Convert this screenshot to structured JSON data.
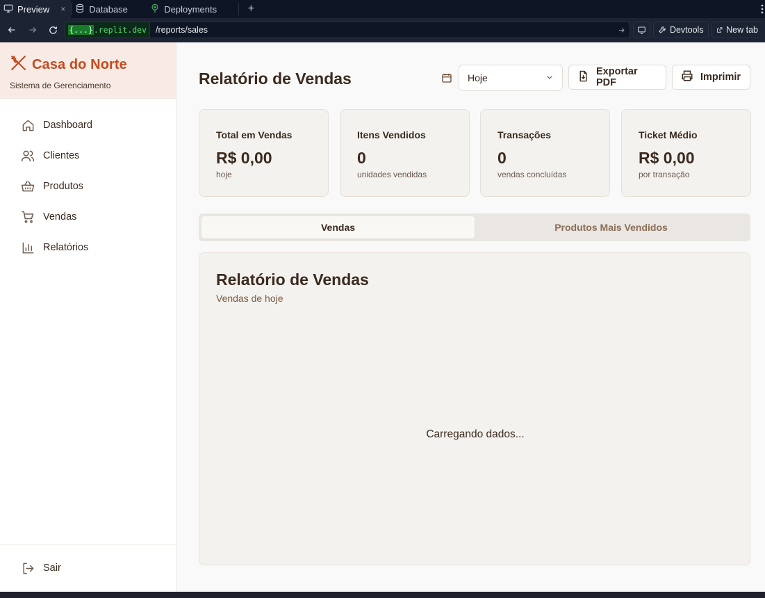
{
  "browser": {
    "tabs": [
      {
        "label": "Preview",
        "icon": "monitor-icon",
        "active": true
      },
      {
        "label": "Database",
        "icon": "database-icon",
        "active": false
      },
      {
        "label": "Deployments",
        "icon": "deployments-icon",
        "active": false
      }
    ],
    "close_glyph": "×",
    "new_tab_glyph": "+",
    "url": {
      "domain_highlight": "{...}",
      "domain": ".replit.dev",
      "path": "/reports/sales"
    },
    "devtools_label": "Devtools",
    "new_tab_label": "New tab"
  },
  "sidebar": {
    "brand_title": "Casa do Norte",
    "brand_subtitle": "Sistema de Gerenciamento",
    "items": [
      {
        "label": "Dashboard",
        "icon": "home-icon"
      },
      {
        "label": "Clientes",
        "icon": "users-icon"
      },
      {
        "label": "Produtos",
        "icon": "basket-icon"
      },
      {
        "label": "Vendas",
        "icon": "cart-icon"
      },
      {
        "label": "Relatórios",
        "icon": "bar-chart-icon"
      }
    ],
    "logout_label": "Sair"
  },
  "main": {
    "title": "Relatório de Vendas",
    "period_select": "Hoje",
    "export_label": "Exportar PDF",
    "print_label": "Imprimir",
    "stats": [
      {
        "title": "Total em Vendas",
        "value": "R$ 0,00",
        "sub": "hoje"
      },
      {
        "title": "Itens Vendidos",
        "value": "0",
        "sub": "unidades vendidas"
      },
      {
        "title": "Transações",
        "value": "0",
        "sub": "vendas concluídas"
      },
      {
        "title": "Ticket Médio",
        "value": "R$ 0,00",
        "sub": "por transação"
      }
    ],
    "tabs": [
      {
        "label": "Vendas",
        "active": true
      },
      {
        "label": "Produtos Mais Vendidos",
        "active": false
      }
    ],
    "card": {
      "title": "Relatório de Vendas",
      "subtitle": "Vendas de hoje",
      "loading": "Carregando dados..."
    }
  },
  "colors": {
    "accent": "#c34a1e",
    "brand_bg": "#f8ebe5",
    "text": "#3b2a1e"
  }
}
